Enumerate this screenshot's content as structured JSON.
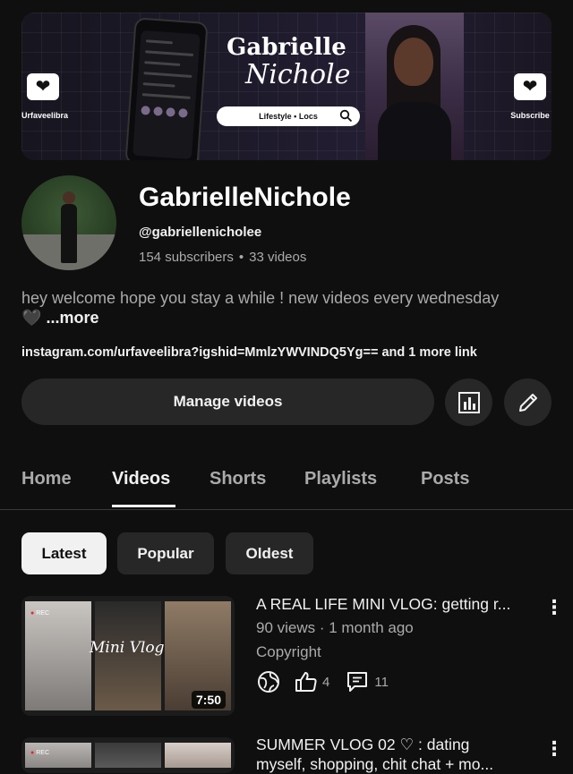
{
  "banner": {
    "left_caption": "Urfaveelibra",
    "right_caption": "Subscribe",
    "name_line1": "Gabrielle",
    "name_line2": "Nichole",
    "pill_text": "Lifestyle • Locs"
  },
  "channel": {
    "name": "GabrielleNichole",
    "handle": "@gabriellenicholee",
    "subscribers": "154 subscribers",
    "videos_count": "33 videos",
    "description": "hey welcome hope you stay a while !  new videos every wednesday",
    "description_emoji": "🖤",
    "more_label": "...more",
    "link": "instagram.com/urfaveelibra?igshid=MmlzYWVINDQ5Yg== and 1 more link"
  },
  "actions": {
    "manage_videos": "Manage videos"
  },
  "tabs": [
    {
      "label": "Home"
    },
    {
      "label": "Videos"
    },
    {
      "label": "Shorts"
    },
    {
      "label": "Playlists"
    },
    {
      "label": "Posts"
    }
  ],
  "active_tab": "Videos",
  "chips": [
    {
      "label": "Latest"
    },
    {
      "label": "Popular"
    },
    {
      "label": "Oldest"
    }
  ],
  "videos": [
    {
      "title": "A REAL LIFE MINI VLOG: getting r...",
      "meta": "90 views · 1 month ago",
      "status": "Copyright",
      "duration": "7:50",
      "thumb_text": "Mini Vlog",
      "rec_label": "REC",
      "likes": "4",
      "comments": "11"
    },
    {
      "title_line1": "SUMMER VLOG 02 ♡ : dating",
      "title_line2": "myself, shopping, chit chat + mo...",
      "rec_label": "REC"
    }
  ],
  "colors": {
    "background": "#0f0f0f",
    "surface": "#272727",
    "text_primary": "#f1f1f1",
    "text_secondary": "#aaaaaa"
  }
}
